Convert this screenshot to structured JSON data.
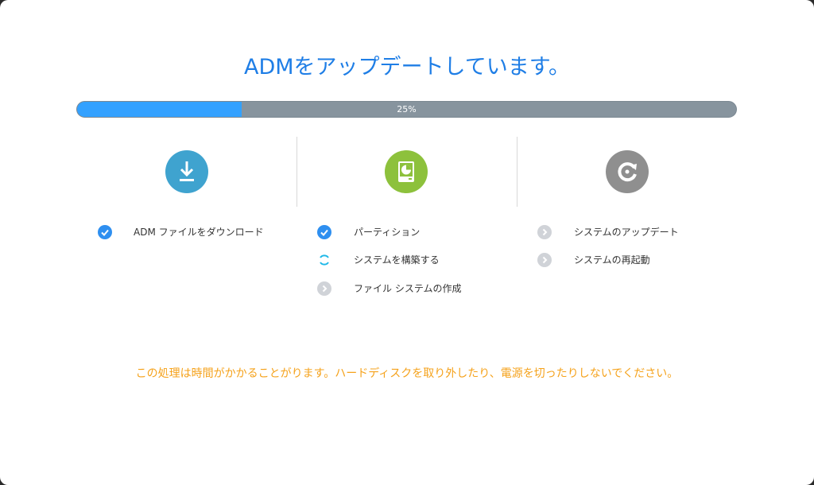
{
  "title": "ADMをアップデートしています。",
  "progress": {
    "percent": 25,
    "label": "25%"
  },
  "colors": {
    "accent": "#33a1ff",
    "done": "#2e8ff0",
    "pending": "#d0d3d8",
    "warn": "#f5a21b"
  },
  "steps": [
    {
      "icon": "download-icon",
      "color": "#3fa3cf",
      "items": [
        {
          "label": "ADM ファイルをダウンロード",
          "status": "done"
        }
      ]
    },
    {
      "icon": "disk-partition-icon",
      "color": "#8dc13c",
      "items": [
        {
          "label": "パーティション",
          "status": "done"
        },
        {
          "label": "システムを構築する",
          "status": "in-progress"
        },
        {
          "label": "ファイル システムの作成",
          "status": "pending"
        }
      ]
    },
    {
      "icon": "restart-icon",
      "color": "#8f8f8f",
      "items": [
        {
          "label": "システムのアップデート",
          "status": "pending"
        },
        {
          "label": "システムの再起動",
          "status": "pending"
        }
      ]
    }
  ],
  "warning": "この処理は時間がかかることがります。ハードディスクを取り外したり、電源を切ったりしないでください。"
}
